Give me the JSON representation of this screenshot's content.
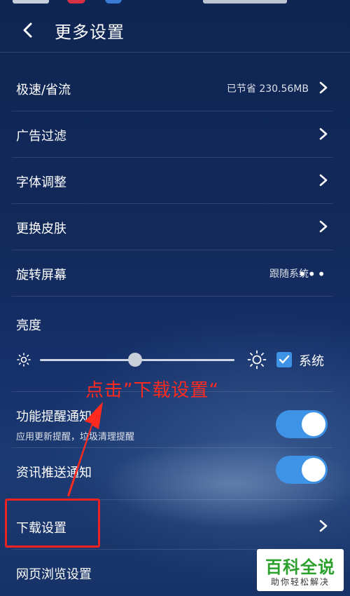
{
  "header": {
    "title": "更多设置"
  },
  "rows": [
    {
      "label": "极速/省流",
      "value": "已节省 230.56MB"
    },
    {
      "label": "广告过滤"
    },
    {
      "label": "字体调整"
    },
    {
      "label": "更换皮肤"
    },
    {
      "label": "旋转屏幕",
      "value": "跟随系统"
    }
  ],
  "brightness": {
    "label": "亮度",
    "level_percent": 49,
    "system_label": "系统",
    "system_checked": true
  },
  "notifications": [
    {
      "label": "功能提醒通知",
      "sub": "应用更新提醒，垃圾清理提醒",
      "enabled": true
    },
    {
      "label": "资讯推送通知",
      "enabled": true
    }
  ],
  "download": {
    "label": "下载设置"
  },
  "browse": {
    "label": "网页浏览设置"
  },
  "annotation": {
    "text": "点击”下载设置“"
  },
  "watermark": {
    "title": "百科全说",
    "subtitle": "助你轻松解决"
  },
  "colors": {
    "accent": "#3f93e6",
    "annotation": "#ff2a1f",
    "watermark": "#2ca02c"
  }
}
